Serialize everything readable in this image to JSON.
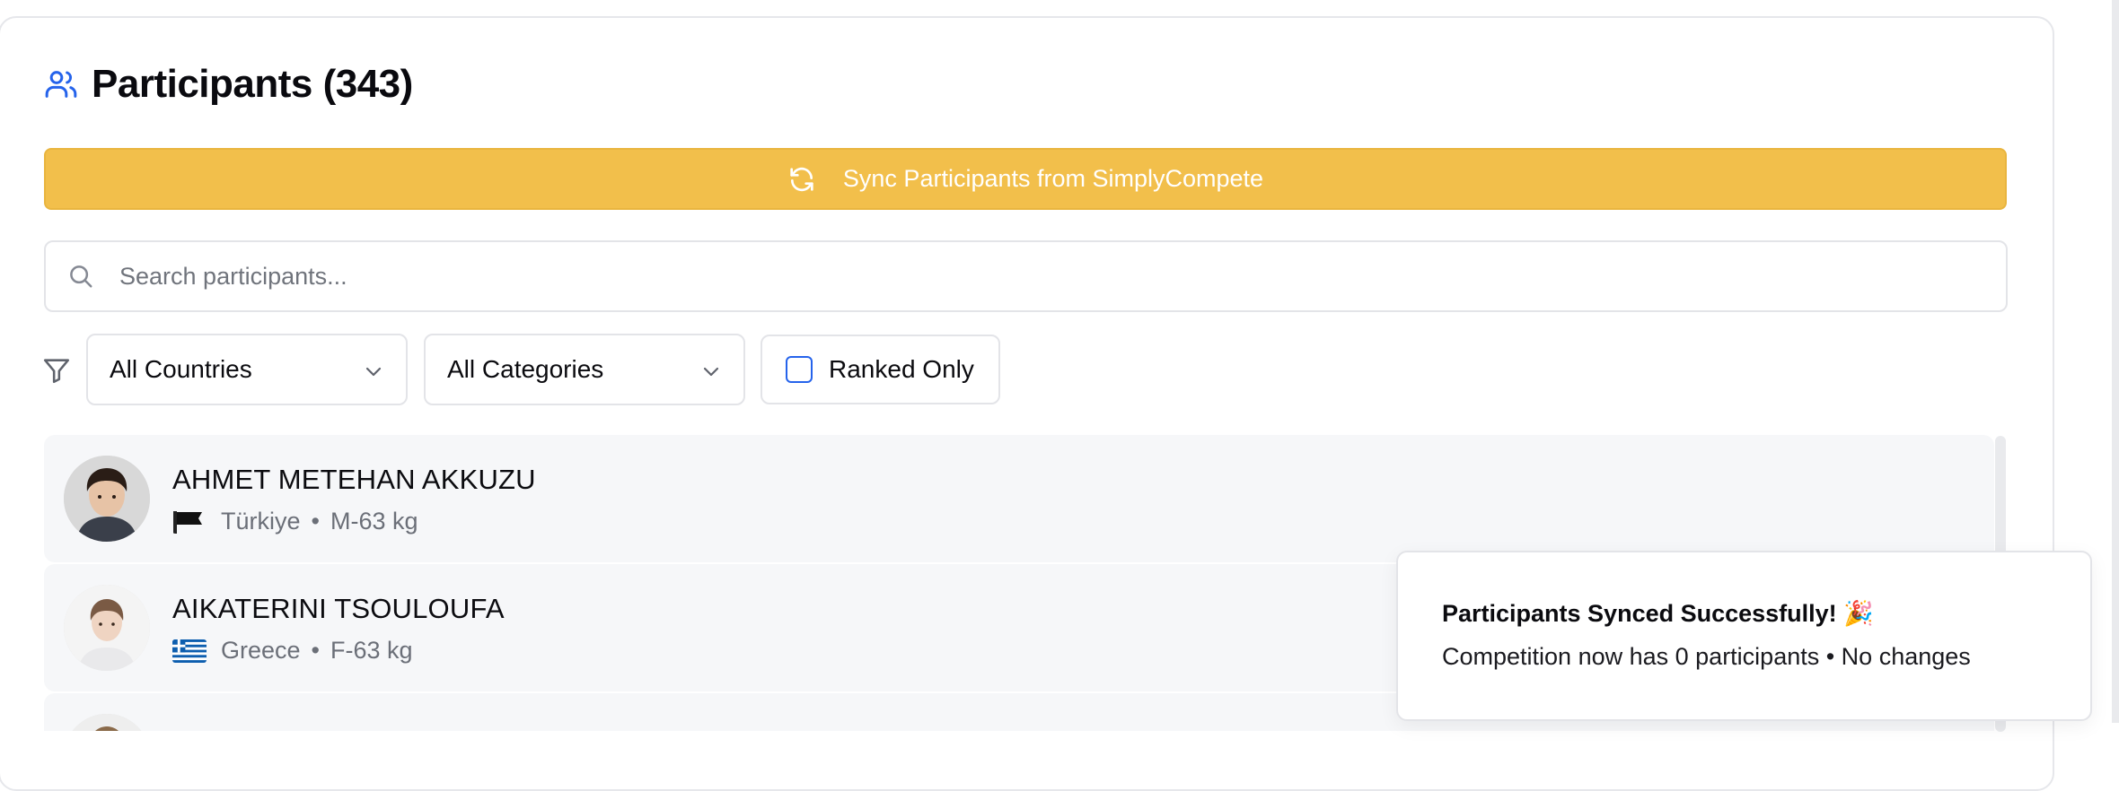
{
  "header": {
    "title": "Participants (343)",
    "icon": "users-icon"
  },
  "sync": {
    "label": "Sync Participants from SimplyCompete",
    "icon": "refresh-icon",
    "color": "#f2bf4b"
  },
  "search": {
    "placeholder": "Search participants...",
    "value": ""
  },
  "filters": {
    "icon": "filter-icon",
    "country": "All Countries",
    "category": "All Categories",
    "ranked_label": "Ranked Only",
    "ranked_checked": false
  },
  "participants": [
    {
      "name": "AHMET METEHAN AKKUZU",
      "country": "Türkiye",
      "separator": "•",
      "category": "M-63 kg",
      "flag": "black-flag-icon"
    },
    {
      "name": "AIKATERINI TSOULOUFA",
      "country": "Greece",
      "separator": "•",
      "category": "F-63 kg",
      "flag": "greece-flag-icon"
    }
  ],
  "toast": {
    "title": "Participants Synced Successfully! 🎉",
    "description": "Competition now has 0 participants • No changes"
  },
  "colors": {
    "accent": "#2563eb",
    "sync_button": "#f2bf4b",
    "row_bg": "#f6f7f9"
  }
}
